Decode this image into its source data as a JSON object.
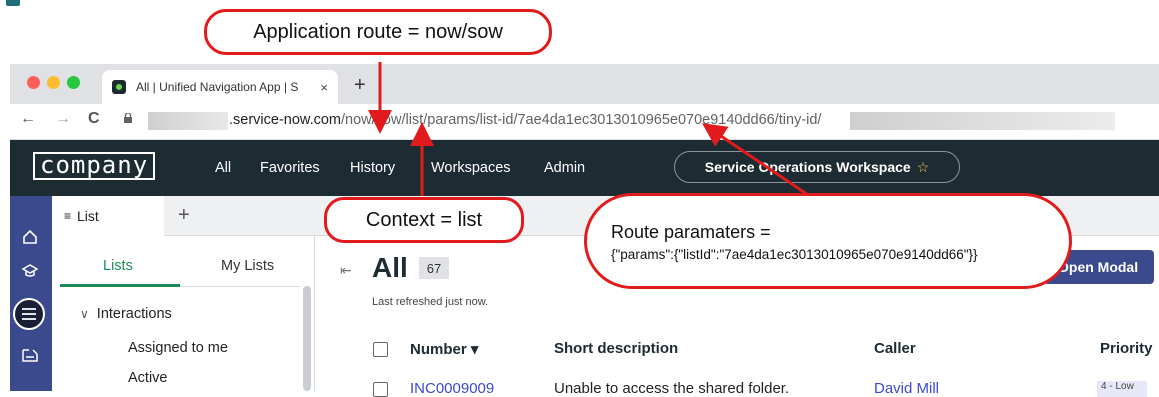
{
  "browser": {
    "tab_title": "All | Unified Navigation App | S",
    "tab_close": "×",
    "new_tab": "+",
    "nav_back": "←",
    "nav_forward": "→",
    "nav_reload": "C",
    "url_host": ".service-now.com",
    "url_path": "/now/sow/list/params/list-id/7ae4da1ec3013010965e070e9140dd66/tiny-id/"
  },
  "header": {
    "logo": "company",
    "nav": [
      "All",
      "Favorites",
      "History",
      "Workspaces",
      "Admin"
    ],
    "workspace": "Service Operations Workspace",
    "workspace_star": "☆"
  },
  "workspace_tabs": {
    "tab_label": "List",
    "add": "+"
  },
  "lists_panel": {
    "tabs": [
      "Lists",
      "My Lists"
    ],
    "group": "Interactions",
    "items": [
      "Assigned to me",
      "Active"
    ]
  },
  "main": {
    "title": "All",
    "count": "67",
    "refreshed": "Last refreshed just now.",
    "button": "Open Modal",
    "columns": [
      "Number",
      "Short description",
      "Caller",
      "Priority"
    ],
    "sort_indicator": "▾",
    "row": {
      "number": "INC0009009",
      "description": "Unable to access the shared folder.",
      "caller": "David Mill",
      "priority": "4 - Low"
    }
  },
  "annotations": {
    "app_route": "Application route = now/sow",
    "context": "Context = list",
    "route_params_title": "Route paramaters =",
    "route_params_value": "{\"params\":{\"listId\":\"7ae4da1ec3013010965e070e9140dd66\"}}"
  },
  "colors": {
    "annotation": "#e11b1b",
    "app_header": "#1d2b33",
    "rail": "#3a4a8c",
    "accent_green": "#1d8a56"
  }
}
